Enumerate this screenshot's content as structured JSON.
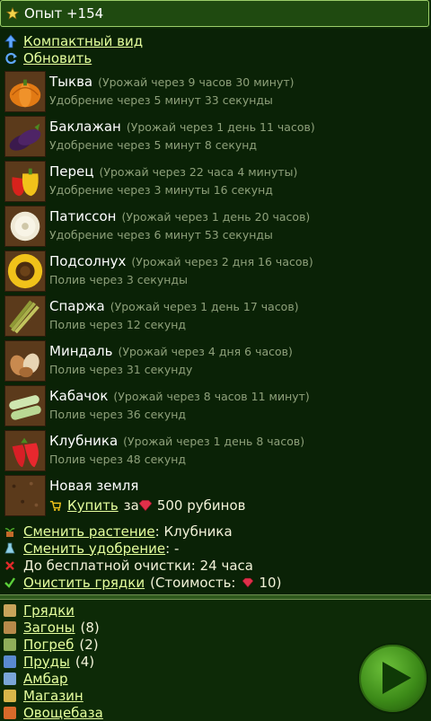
{
  "top": {
    "text": "Опыт +154"
  },
  "links": {
    "compact": "Компактный вид",
    "refresh": "Обновить"
  },
  "plants": [
    {
      "name": "Тыква",
      "harvest": "(Урожай через 9 часов 30 минут)",
      "sub": "Удобрение через 5 минут 33 секунды",
      "icon": "pumpkin-icon"
    },
    {
      "name": "Баклажан",
      "harvest": "(Урожай через 1 день 11 часов)",
      "sub": "Удобрение через 5 минут 8 секунд",
      "icon": "eggplant-icon"
    },
    {
      "name": "Перец",
      "harvest": "(Урожай через 22 часа 4 минуты)",
      "sub": "Удобрение через 3 минуты 16 секунд",
      "icon": "pepper-icon"
    },
    {
      "name": "Патиссон",
      "harvest": "(Урожай через 1 день 20 часов)",
      "sub": "Удобрение через 6 минут 53 секунды",
      "icon": "pattypan-icon"
    },
    {
      "name": "Подсолнух",
      "harvest": "(Урожай через 2 дня 16 часов)",
      "sub": "Полив через 3 секунды",
      "icon": "sunflower-icon"
    },
    {
      "name": "Спаржа",
      "harvest": "(Урожай через 1 день 17 часов)",
      "sub": "Полив через 12 секунд",
      "icon": "asparagus-icon"
    },
    {
      "name": "Миндаль",
      "harvest": "(Урожай через 4 дня 6 часов)",
      "sub": "Полив через 31 секунду",
      "icon": "almond-icon"
    },
    {
      "name": "Кабачок",
      "harvest": "(Урожай через 8 часов 11 минут)",
      "sub": "Полив через 36 секунд",
      "icon": "zucchini-icon"
    },
    {
      "name": "Клубника",
      "harvest": "(Урожай через 1 день 8 часов)",
      "sub": "Полив через 48 секунд",
      "icon": "strawberry-icon"
    }
  ],
  "newland": {
    "title": "Новая земля",
    "buy": "Купить",
    "for": "за",
    "price": "500 рубинов"
  },
  "actions": {
    "change_plant": "Сменить растение",
    "change_plant_value": ": Клубника",
    "change_fert": "Сменить удобрение",
    "change_fert_value": ": -",
    "free_clean": "До бесплатной очистки: 24 часа",
    "clean": "Очистить грядки",
    "clean_cost_prefix": "(Стоимость:",
    "clean_cost_suffix": "10)"
  },
  "menu": [
    {
      "label": "Грядки",
      "count": ""
    },
    {
      "label": "Загоны",
      "count": "(8)"
    },
    {
      "label": "Погреб",
      "count": "(2)"
    },
    {
      "label": "Пруды",
      "count": "(4)"
    },
    {
      "label": "Амбар",
      "count": ""
    },
    {
      "label": "Магазин",
      "count": ""
    },
    {
      "label": "Овощебаза",
      "count": ""
    }
  ],
  "colors": {
    "link": "#e6ff9e",
    "muted": "#8ea07a",
    "ruby": "#e0304a",
    "accent": "#3c8a18"
  }
}
